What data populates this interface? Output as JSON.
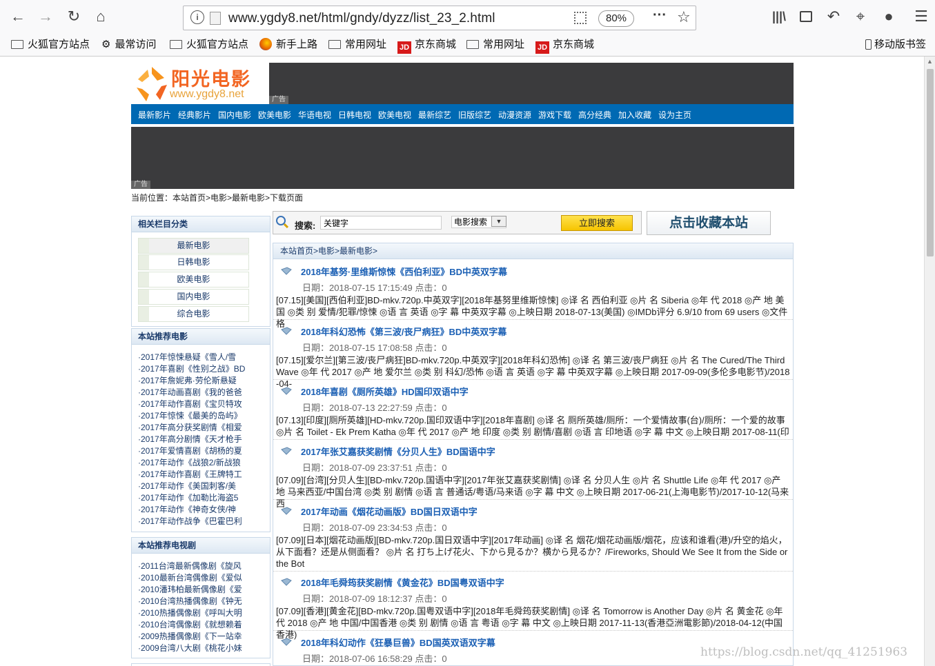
{
  "browser": {
    "url": "www.ygdy8.net/html/gndy/dyzz/list_23_2.html",
    "zoom": "80%",
    "bookmarks": [
      "火狐官方站点",
      "最常访问",
      "火狐官方站点",
      "新手上路",
      "常用网址",
      "京东商城",
      "常用网址",
      "京东商城"
    ],
    "mobile_bookmarks": "移动版书签"
  },
  "site": {
    "logo_text": "阳光电影",
    "logo_url": "www.ygdy8.net",
    "ad_label": "广告",
    "nav": [
      "最新影片",
      "经典影片",
      "国内电影",
      "欧美电影",
      "华语电视",
      "日韩电视",
      "欧美电视",
      "最新综艺",
      "旧版综艺",
      "动漫资源",
      "游戏下载",
      "高分经典",
      "加入收藏",
      "设为主页"
    ],
    "breadcrumb": "当前位置：本站首页>电影>最新电影>下载页面"
  },
  "sidebar": {
    "categories_title": "相关栏目分类",
    "categories": [
      "最新电影",
      "日韩电影",
      "欧美电影",
      "国内电影",
      "综合电影"
    ],
    "rec_movies_title": "本站推荐电影",
    "rec_movies": [
      "·2017年惊悚悬疑《雪人/雪",
      "·2017年喜剧《性别之战》BD",
      "·2017年詹妮弗·劳伦斯悬疑",
      "·2017年动画喜剧《我的爸爸",
      "·2017年动作喜剧《宝贝特攻",
      "·2017年惊悚《最美的岛屿》",
      "·2017年高分获奖剧情《相爱",
      "·2017年高分剧情《天才枪手",
      "·2017年爱情喜剧《胡杨的夏",
      "·2017年动作《战狼2/新战狼",
      "·2017年动作喜剧《王牌特工",
      "·2017年动作《美国刺客/美",
      "·2017年动作《加勒比海盗5",
      "·2017年动作《神奇女侠/神",
      "·2017年动作战争《巴霍巴利"
    ],
    "rec_tv_title": "本站推荐电视剧",
    "rec_tv": [
      "·2011台湾最新偶像剧《旋风",
      "·2010最新台湾偶像剧《爱似",
      "·2010潘玮柏最新偶像剧《爱",
      "·2010台湾热播偶像剧《钟无",
      "·2010热播偶像剧《呼叫大明",
      "·2010台湾偶像剧《就想赖着",
      "·2009热播偶像剧《下一站幸",
      "·2009台湾八大剧《桃花小妹"
    ]
  },
  "search": {
    "label": "搜索:",
    "placeholder": "关键字",
    "select_value": "电影搜索",
    "button": "立即搜索",
    "favorite": "点击收藏本站"
  },
  "main": {
    "breadcrumb": "本站首页>电影>最新电影>",
    "entries": [
      {
        "title": "2018年基努·里维斯惊悚《西伯利亚》BD中英双字幕",
        "date": "日期：2018-07-15 17:15:49 点击：0",
        "desc": "[07.15][美国][西伯利亚]BD-mkv.720p.中英双字][2018年基努里维斯惊悚] ◎译 名 西伯利亚 ◎片 名 Siberia ◎年 代 2018 ◎产 地 美国 ◎类 别 爱情/犯罪/惊悚 ◎语 言 英语 ◎字 幕 中英双字幕 ◎上映日期 2018-07-13(美国) ◎IMDb评分 6.9/10 from 69 users ◎文件格"
      },
      {
        "title": "2018年科幻恐怖《第三波/丧尸病狂》BD中英双字幕",
        "date": "日期：2018-07-15 17:08:58 点击：0",
        "desc": "[07.15][爱尔兰][第三波/丧尸病狂]BD-mkv.720p.中英双字][2018年科幻恐怖] ◎译 名 第三波/丧尸病狂 ◎片 名 The Cured/The Third Wave ◎年 代 2017 ◎产 地 爱尔兰 ◎类 别 科幻/恐怖 ◎语 言 英语 ◎字 幕 中英双字幕 ◎上映日期 2017-09-09(多伦多电影节)/2018-04-"
      },
      {
        "title": "2018年喜剧《厕所英雄》HD国印双语中字",
        "date": "日期：2018-07-13 22:27:59 点击：0",
        "desc": "[07.13][印度][厕所英雄][HD-mkv.720p.国印双语中字][2018年喜剧] ◎译 名 厕所英雄/厕所：一个爱情故事(台)/厕所：一个爱的故事 ◎片 名 Toilet - Ek Prem Katha ◎年 代 2017 ◎产 地 印度 ◎类 别 剧情/喜剧 ◎语 言 印地语 ◎字 幕 中文 ◎上映日期 2017-08-11(印"
      },
      {
        "title": "2017年张艾嘉获奖剧情《分贝人生》BD国语中字",
        "date": "日期：2018-07-09 23:37:51 点击：0",
        "desc": "[07.09][台湾][分贝人生][BD-mkv.720p.国语中字][2017年张艾嘉获奖剧情] ◎译 名 分贝人生 ◎片 名 Shuttle Life ◎年 代 2017 ◎产 地 马来西亚/中国台湾 ◎类 别 剧情 ◎语 言 普通话/粤语/马来语 ◎字 幕 中文 ◎上映日期 2017-06-21(上海电影节)/2017-10-12(马来西"
      },
      {
        "title": "2017年动画《烟花动画版》BD国日双语中字",
        "date": "日期：2018-07-09 23:34:53 点击：0",
        "desc": "[07.09][日本][烟花动画版][BD-mkv.720p.国日双语中字][2017年动画] ◎译 名 烟花/烟花动画版/烟花，应该和谁看(港)/升空的焰火，从下面看？还是从侧面看？ ◎片 名 打ち上げ花火、下から見るか？横から見るか？/Fireworks, Should We See It from the Side or the Bot"
      },
      {
        "title": "2018年毛舜筠获奖剧情《黄金花》BD国粤双语中字",
        "date": "日期：2018-07-09 18:12:37 点击：0",
        "desc": "[07.09][香港][黄金花][BD-mkv.720p.国粤双语中字][2018年毛舜筠获奖剧情] ◎译 名 Tomorrow is Another Day ◎片 名 黄金花 ◎年 代 2018 ◎产 地 中国/中国香港 ◎类 别 剧情 ◎语 言 粤语 ◎字 幕 中文 ◎上映日期 2017-11-13(香港亞洲電影節)/2018-04-12(中国香港)"
      },
      {
        "title": "2018年科幻动作《狂暴巨兽》BD国英双语双字幕",
        "date": "日期：2018-07-06 16:58:29 点击：0",
        "desc": ""
      }
    ]
  },
  "watermark": "https://blog.csdn.net/qq_41251963"
}
